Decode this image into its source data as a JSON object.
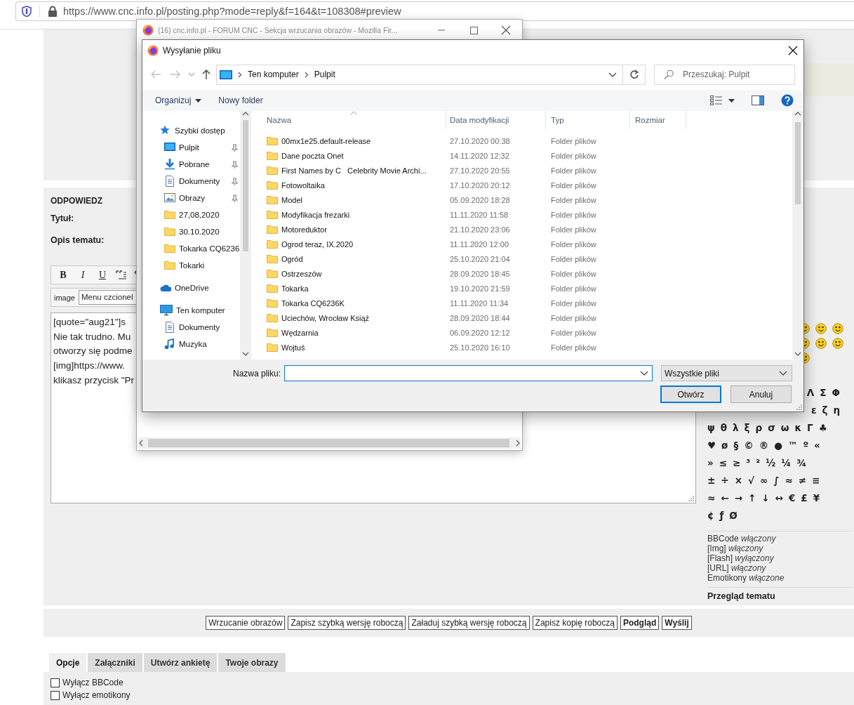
{
  "browser": {
    "url": "https://www.cnc.info.pl/posting.php?mode=reply&f=164&t=108308#preview"
  },
  "forum": {
    "section_title": "ODPOWIEDZ",
    "fields": [
      {
        "label": "Tytuł:"
      },
      {
        "label": "Opis tematu:"
      }
    ],
    "format_buttons": [
      {
        "label": "B",
        "kind": "bold"
      },
      {
        "label": "I",
        "kind": "italic"
      },
      {
        "label": "U",
        "kind": "underline"
      }
    ],
    "image_label": "image",
    "font_menu": "Menu czcionel",
    "post_lines": [
      "[quote=\"aug21\"]s",
      "Nie tak trudno. Mu",
      "otworzy się podme",
      "[img]https://www.",
      "klikasz przycisk \"Pr"
    ],
    "symbols": [
      [
        "Λ",
        "Σ",
        "Φ"
      ],
      [
        "ε",
        "ζ",
        "η"
      ],
      [
        "ψ",
        "θ",
        "λ",
        "ξ",
        "ρ",
        "σ",
        "ω",
        "κ",
        "Γ",
        "♣"
      ],
      [
        "♥",
        "ø",
        "§",
        "©",
        "®",
        "●",
        "™",
        "º",
        "«"
      ],
      [
        "»",
        "≤",
        "≥",
        "³",
        "²",
        "½",
        "¼",
        "¾"
      ],
      [
        "±",
        "÷",
        "×",
        "√",
        "∞",
        "∫",
        "≈",
        "≠",
        "≡"
      ],
      [
        "≈",
        "←",
        "→",
        "↑",
        "↓",
        "↔",
        "€",
        "£",
        "¥"
      ],
      [
        "¢",
        "ƒ",
        "Ø"
      ]
    ],
    "status": [
      "BBCode *włączony*",
      "[Img] *włączony*",
      "[Flash] *wyłączony*",
      "[URL] *włączony*",
      "Emotikony *włączone*"
    ],
    "topic_review": "Przegląd tematu",
    "actions": [
      {
        "label": "Wrzucanie obrazów",
        "primary": false
      },
      {
        "label": "Zapisz szybką wersję roboczą",
        "primary": false
      },
      {
        "label": "Załaduj szybką wersję roboczą",
        "primary": false
      },
      {
        "label": "Zapisz kopię roboczą",
        "primary": false
      },
      {
        "label": "Podgląd",
        "primary": true
      },
      {
        "label": "Wyślij",
        "primary": true
      }
    ],
    "tabs": [
      {
        "label": "Opcje",
        "selected": true
      },
      {
        "label": "Załączniki",
        "selected": false
      },
      {
        "label": "Utwórz ankietę",
        "selected": false
      },
      {
        "label": "Twoje obrazy",
        "selected": false
      }
    ],
    "options": [
      {
        "label": "Wyłącz BBCode",
        "checked": false
      },
      {
        "label": "Wyłącz emotikony",
        "checked": false
      }
    ]
  },
  "popup_window": {
    "title": "(16) cnc.info.pl - FORUM CNC - Sekcja wrzucania obrazów - Mozilla Fir..."
  },
  "file_dialog": {
    "title": "Wysyłanie pliku",
    "breadcrumb": [
      "Ten komputer",
      "Pulpit"
    ],
    "search_placeholder": "Przeszukaj: Pulpit",
    "toolbar": [
      "Organizuj",
      "Nowy folder"
    ],
    "nav": [
      {
        "label": "Szybki dostęp",
        "kind": "star",
        "children": [
          {
            "label": "Pulpit",
            "kind": "desktop",
            "pinned": true
          },
          {
            "label": "Pobrane",
            "kind": "download",
            "pinned": true
          },
          {
            "label": "Dokumenty",
            "kind": "document",
            "pinned": true
          },
          {
            "label": "Obrazy",
            "kind": "pictures",
            "pinned": true
          },
          {
            "label": "27,08,2020",
            "kind": "folder",
            "pinned": false
          },
          {
            "label": "30.10.2020",
            "kind": "folder",
            "pinned": false
          },
          {
            "label": "Tokarka CQ6236",
            "kind": "folder",
            "pinned": false
          },
          {
            "label": "Tokarki",
            "kind": "folder",
            "pinned": false
          }
        ]
      },
      {
        "label": "OneDrive",
        "kind": "cloud"
      },
      {
        "label": "Ten komputer",
        "kind": "computer",
        "children": [
          {
            "label": "Dokumenty",
            "kind": "document",
            "pinned": false
          },
          {
            "label": "Muzyka",
            "kind": "music",
            "pinned": false
          }
        ]
      }
    ],
    "columns": [
      "Nazwa",
      "Data modyfikacji",
      "Typ",
      "Rozmiar"
    ],
    "files": [
      {
        "name": "00mx1e25.default-release",
        "modified": "27.10.2020 00:38",
        "type": "Folder plików"
      },
      {
        "name": "Dane poczta Onet",
        "modified": "14.11.2020 12:32",
        "type": "Folder plików"
      },
      {
        "name": "First Names by C   Celebrity Movie Archi...",
        "modified": "27.10.2020 20:55",
        "type": "Folder plików"
      },
      {
        "name": "Fotowoltaika",
        "modified": "17.10.2020 20:12",
        "type": "Folder plików"
      },
      {
        "name": "Model",
        "modified": "05.09.2020 18:28",
        "type": "Folder plików"
      },
      {
        "name": "Modyfikacja frezarki",
        "modified": "11.11.2020 11:58",
        "type": "Folder plików"
      },
      {
        "name": "Motoreduktor",
        "modified": "21.10.2020 23:06",
        "type": "Folder plików"
      },
      {
        "name": "Ogrod teraz, IX.2020",
        "modified": "11.11.2020 12:00",
        "type": "Folder plików"
      },
      {
        "name": "Ogród",
        "modified": "25.10.2020 21:04",
        "type": "Folder plików"
      },
      {
        "name": "Ostrzeszów",
        "modified": "28.09.2020 18:45",
        "type": "Folder plików"
      },
      {
        "name": "Tokarka",
        "modified": "19.10.2020 21:59",
        "type": "Folder plików"
      },
      {
        "name": "Tokarka CQ6236K",
        "modified": "11.11.2020 11:34",
        "type": "Folder plików"
      },
      {
        "name": "Uciechów, Wrocław Książ",
        "modified": "28.09.2020 18:44",
        "type": "Folder plików"
      },
      {
        "name": "Wędzarnia",
        "modified": "06.09.2020 12:12",
        "type": "Folder plików"
      },
      {
        "name": "Wojtuś",
        "modified": "25.10.2020 16:10",
        "type": "Folder plików"
      }
    ],
    "filename_label": "Nazwa pliku:",
    "filter": "Wszystkie pliki",
    "buttons": [
      {
        "label": "Otwórz",
        "default": true
      },
      {
        "label": "Anuluj",
        "default": false
      }
    ]
  }
}
